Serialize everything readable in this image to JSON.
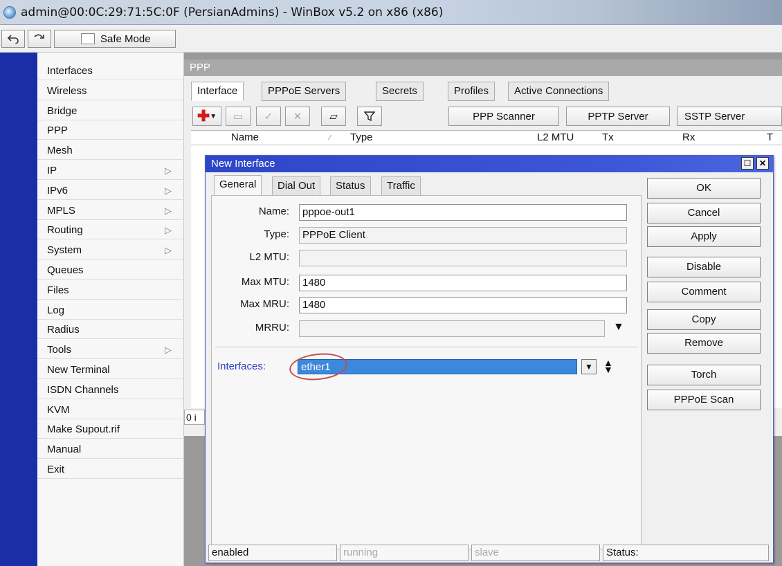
{
  "window": {
    "title": "admin@00:0C:29:71:5C:0F (PersianAdmins) - WinBox v5.2 on x86 (x86)"
  },
  "toolbar": {
    "undo_icon": "undo-icon",
    "redo_icon": "redo-icon",
    "safe_mode": "Safe Mode"
  },
  "menu": {
    "items": [
      {
        "label": "Interfaces",
        "sub": false
      },
      {
        "label": "Wireless",
        "sub": false
      },
      {
        "label": "Bridge",
        "sub": false
      },
      {
        "label": "PPP",
        "sub": false
      },
      {
        "label": "Mesh",
        "sub": false
      },
      {
        "label": "IP",
        "sub": true
      },
      {
        "label": "IPv6",
        "sub": true
      },
      {
        "label": "MPLS",
        "sub": true
      },
      {
        "label": "Routing",
        "sub": true
      },
      {
        "label": "System",
        "sub": true
      },
      {
        "label": "Queues",
        "sub": false
      },
      {
        "label": "Files",
        "sub": false
      },
      {
        "label": "Log",
        "sub": false
      },
      {
        "label": "Radius",
        "sub": false
      },
      {
        "label": "Tools",
        "sub": true
      },
      {
        "label": "New Terminal",
        "sub": false
      },
      {
        "label": "ISDN Channels",
        "sub": false
      },
      {
        "label": "KVM",
        "sub": false
      },
      {
        "label": "Make Supout.rif",
        "sub": false
      },
      {
        "label": "Manual",
        "sub": false
      },
      {
        "label": "Exit",
        "sub": false
      }
    ]
  },
  "ppp": {
    "title": "PPP",
    "tabs": [
      "Interface",
      "PPPoE Servers",
      "Secrets",
      "Profiles",
      "Active Connections"
    ],
    "buttons": {
      "scanner": "PPP Scanner",
      "pptp": "PPTP Server",
      "sstp": "SSTP Server"
    },
    "columns": {
      "name": "Name",
      "type": "Type",
      "l2mtu": "L2 MTU",
      "tx": "Tx",
      "rx": "Rx",
      "tx2": "T"
    },
    "items_count": "0 i"
  },
  "dialog": {
    "title": "New Interface",
    "tabs": [
      "General",
      "Dial Out",
      "Status",
      "Traffic"
    ],
    "fields": {
      "name_label": "Name:",
      "name_value": "pppoe-out1",
      "type_label": "Type:",
      "type_value": "PPPoE Client",
      "l2mtu_label": "L2 MTU:",
      "l2mtu_value": "",
      "maxmtu_label": "Max MTU:",
      "maxmtu_value": "1480",
      "maxmru_label": "Max MRU:",
      "maxmru_value": "1480",
      "mrru_label": "MRRU:",
      "mrru_value": "",
      "interfaces_label": "Interfaces:",
      "interfaces_value": "ether1"
    },
    "buttons": {
      "ok": "OK",
      "cancel": "Cancel",
      "apply": "Apply",
      "disable": "Disable",
      "comment": "Comment",
      "copy": "Copy",
      "remove": "Remove",
      "torch": "Torch",
      "pppoe_scan": "PPPoE Scan"
    },
    "status": {
      "enabled": "enabled",
      "running": "running",
      "slave": "slave",
      "status": "Status:"
    }
  }
}
